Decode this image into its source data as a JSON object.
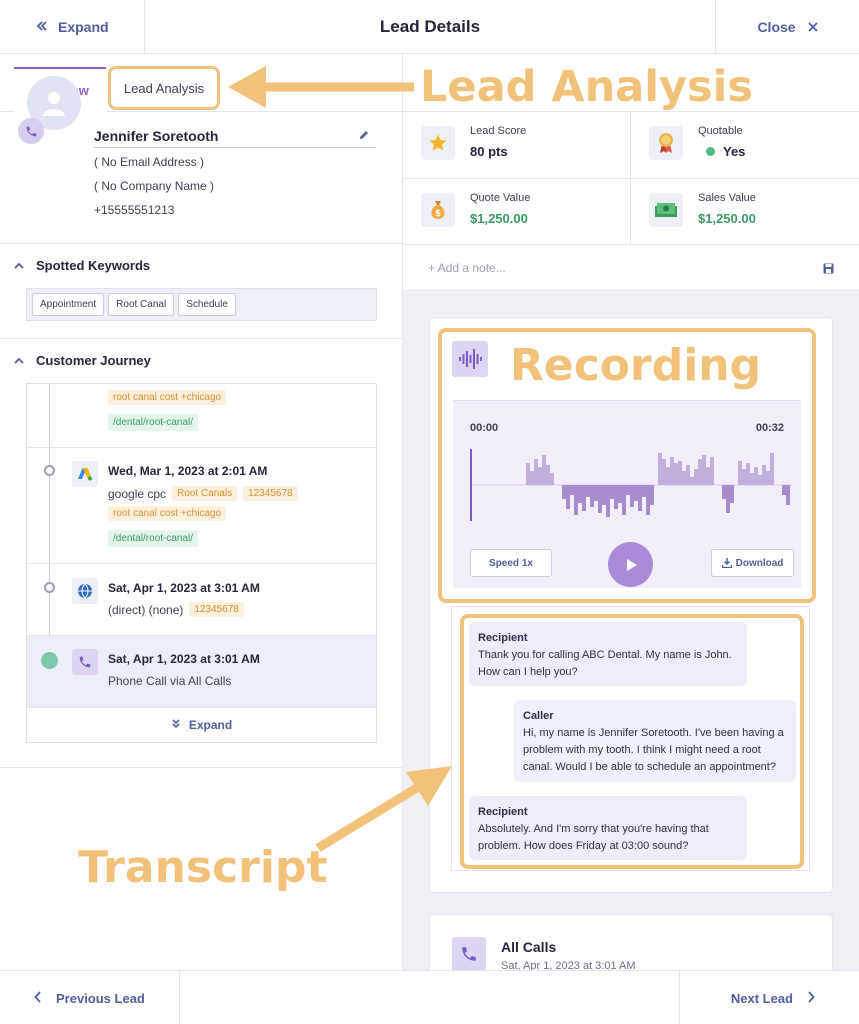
{
  "header": {
    "expand_label": "Expand",
    "title": "Lead Details",
    "close_label": "Close"
  },
  "tabs": [
    {
      "label": "Overview"
    },
    {
      "label": "Lead Analysis"
    }
  ],
  "contact": {
    "name": "Jennifer Soretooth",
    "email": "( No Email Address )",
    "company": "( No Company Name )",
    "phone": "+15555551213"
  },
  "keywords": {
    "title": "Spotted Keywords",
    "items": [
      "Appointment",
      "Root Canal",
      "Schedule"
    ]
  },
  "journey": {
    "title": "Customer Journey",
    "items": [
      {
        "tag_keyword": "root canal cost +chicago",
        "tag_path": "/dental/root-canal/"
      },
      {
        "date": "Wed, Mar 1, 2023 at 2:01 AM",
        "source": "google cpc",
        "tag_campaign": "Root Canals",
        "tag_id": "12345678",
        "tag_keyword": "root canal cost +chicago",
        "tag_path": "/dental/root-canal/"
      },
      {
        "date": "Sat, Apr 1, 2023 at 3:01 AM",
        "source": "(direct) (none)",
        "tag_id": "12345678"
      },
      {
        "date": "Sat, Apr 1, 2023 at 3:01 AM",
        "source": "Phone Call via All Calls"
      }
    ],
    "expand_label": "Expand"
  },
  "stats": {
    "lead_score": {
      "label": "Lead Score",
      "value": "80 pts"
    },
    "quotable": {
      "label": "Quotable",
      "value": "Yes"
    },
    "quote_value": {
      "label": "Quote Value",
      "value": "$1,250.00"
    },
    "sales_value": {
      "label": "Sales Value",
      "value": "$1,250.00"
    }
  },
  "note": {
    "placeholder": "+ Add a note..."
  },
  "recording": {
    "time_start": "00:00",
    "time_end": "00:32",
    "speed_label": "Speed 1x",
    "download_label": "Download"
  },
  "transcript": [
    {
      "speaker": "Recipient",
      "text": "Thank you for calling ABC Dental. My name is John. How can I help you?"
    },
    {
      "speaker": "Caller",
      "text": "Hi, my name is Jennifer Soretooth. I've been having a problem with my tooth. I think I might need a root canal. Would I be able to schedule an appointment?"
    },
    {
      "speaker": "Recipient",
      "text": "Absolutely. And I'm sorry that you're having that problem. How does Friday at 03:00 sound?"
    }
  ],
  "call_card": {
    "title": "All Calls",
    "subtitle": "Sat, Apr 1, 2023 at 3:01 AM"
  },
  "footer": {
    "prev_label": "Previous Lead",
    "next_label": "Next Lead"
  },
  "annotations": {
    "lead_analysis": "Lead Analysis",
    "recording": "Recording",
    "transcript": "Transcript"
  },
  "colors": {
    "accent_purple": "#9b5fc0",
    "link_blue": "#4f5f9e",
    "annotation_orange": "#f3c27a",
    "money_green": "#3a9a66"
  }
}
